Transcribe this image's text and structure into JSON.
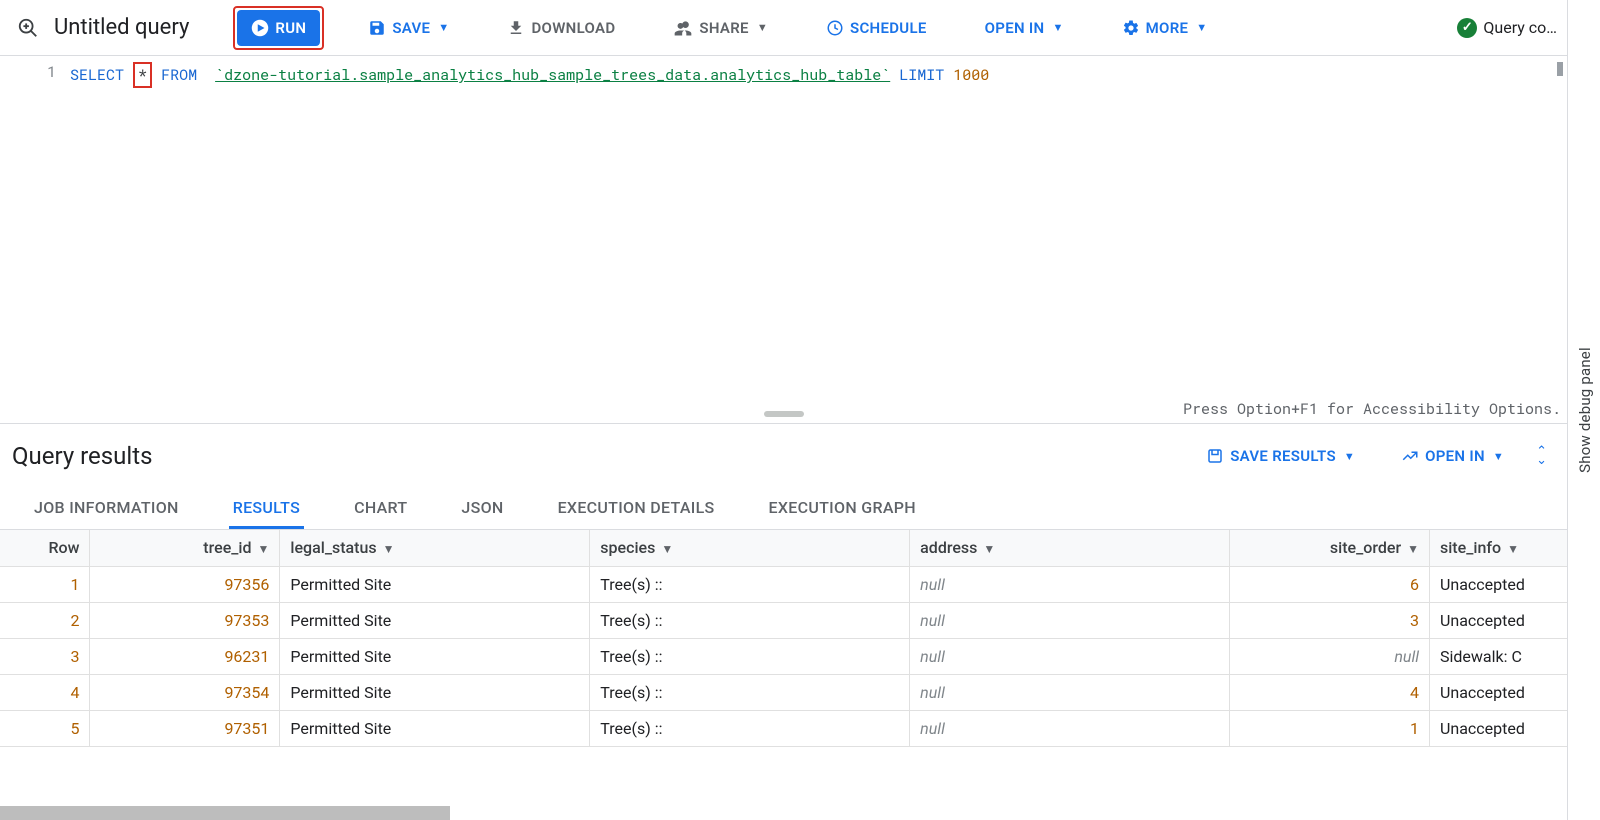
{
  "toolbar": {
    "title": "Untitled query",
    "run_label": "RUN",
    "save_label": "SAVE",
    "download_label": "DOWNLOAD",
    "share_label": "SHARE",
    "schedule_label": "SCHEDULE",
    "open_in_label": "OPEN IN",
    "more_label": "MORE",
    "status_text": "Query co…"
  },
  "editor": {
    "line_number": "1",
    "tokens": {
      "select": "SELECT",
      "star": "*",
      "from": "FROM",
      "table": "`dzone-tutorial.sample_analytics_hub_sample_trees_data.analytics_hub_table`",
      "limit": "LIMIT",
      "limit_n": "1000"
    },
    "accessibility_hint": "Press Option+F1 for Accessibility Options."
  },
  "results": {
    "title": "Query results",
    "save_results_label": "SAVE RESULTS",
    "open_in_label": "OPEN IN",
    "tabs": [
      {
        "label": "JOB INFORMATION"
      },
      {
        "label": "RESULTS"
      },
      {
        "label": "CHART"
      },
      {
        "label": "JSON"
      },
      {
        "label": "EXECUTION DETAILS"
      },
      {
        "label": "EXECUTION GRAPH"
      }
    ],
    "active_tab_index": 1,
    "columns": [
      "Row",
      "tree_id",
      "legal_status",
      "species",
      "address",
      "site_order",
      "site_info"
    ],
    "rows": [
      {
        "row": "1",
        "tree_id": "97356",
        "legal_status": "Permitted Site",
        "species": "Tree(s) ::",
        "address": null,
        "site_order": "6",
        "site_info": "Unaccepted"
      },
      {
        "row": "2",
        "tree_id": "97353",
        "legal_status": "Permitted Site",
        "species": "Tree(s) ::",
        "address": null,
        "site_order": "3",
        "site_info": "Unaccepted"
      },
      {
        "row": "3",
        "tree_id": "96231",
        "legal_status": "Permitted Site",
        "species": "Tree(s) ::",
        "address": null,
        "site_order": null,
        "site_info": "Sidewalk: C"
      },
      {
        "row": "4",
        "tree_id": "97354",
        "legal_status": "Permitted Site",
        "species": "Tree(s) ::",
        "address": null,
        "site_order": "4",
        "site_info": "Unaccepted"
      },
      {
        "row": "5",
        "tree_id": "97351",
        "legal_status": "Permitted Site",
        "species": "Tree(s) ::",
        "address": null,
        "site_order": "1",
        "site_info": "Unaccepted"
      }
    ],
    "null_text": "null"
  },
  "side_panel_label": "Show debug panel"
}
